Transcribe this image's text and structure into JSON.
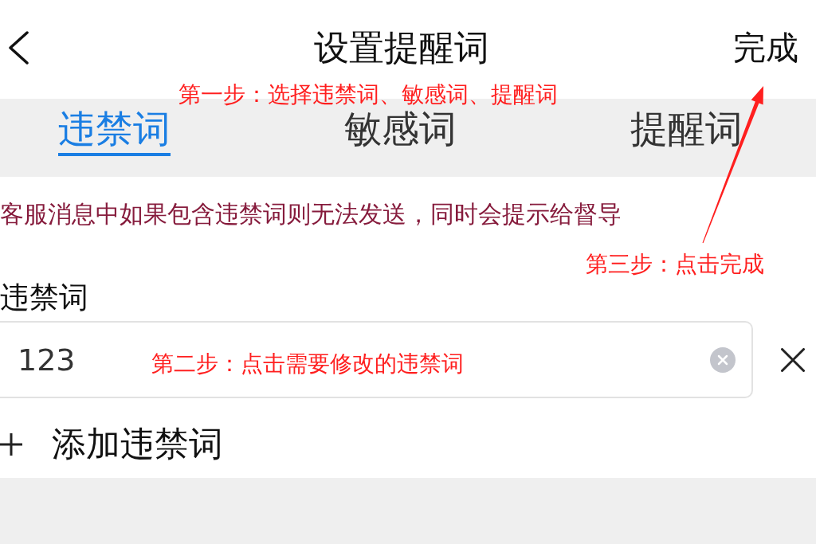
{
  "header": {
    "title": "设置提醒词",
    "done": "完成"
  },
  "tabs": [
    {
      "label": "违禁词",
      "selected": true
    },
    {
      "label": "敏感词",
      "selected": false
    },
    {
      "label": "提醒词",
      "selected": false
    }
  ],
  "notice": "客服消息中如果包含违禁词则无法发送，同时会提示给督导",
  "section": {
    "label": "违禁词",
    "entries": [
      {
        "value": "123"
      }
    ],
    "add_label": "添加违禁词"
  },
  "annotations": [
    {
      "text": "第一步：选择违禁词、敏感词、提醒词"
    },
    {
      "text": "第三步：点击完成"
    },
    {
      "text": "第二步：点击需要修改的违禁词"
    }
  ]
}
